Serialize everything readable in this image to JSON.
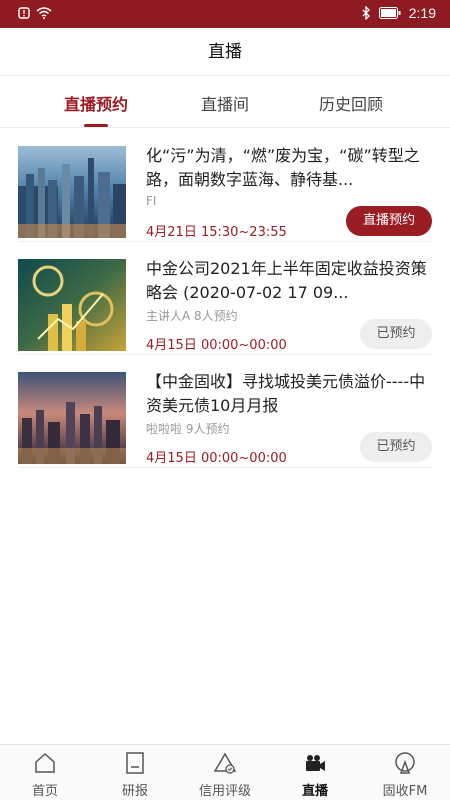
{
  "status_bar": {
    "time": "2:19"
  },
  "header": {
    "title": "直播"
  },
  "tabs": [
    {
      "label": "直播预约"
    },
    {
      "label": "直播间"
    },
    {
      "label": "历史回顾"
    }
  ],
  "items": [
    {
      "title": "化“污”为清，“燃”废为宝，“碳”转型之路，面朝数字蓝海、静待基...",
      "sub": "FI",
      "date": "4月21日 15:30~23:55",
      "button": "直播预约"
    },
    {
      "title": "中金公司2021年上半年固定收益投资策略会 (2020-07-02 17 09...",
      "sub": "主讲人A 8人预约",
      "date": "4月15日 00:00~00:00",
      "button": "已预约"
    },
    {
      "title": "【中金固收】寻找城投美元债溢价----中资美元债10月月报",
      "sub": "啦啦啦 9人预约",
      "date": "4月15日 00:00~00:00",
      "button": "已预约"
    }
  ],
  "nav": [
    {
      "label": "首页",
      "icon": "home-icon"
    },
    {
      "label": "研报",
      "icon": "report-icon"
    },
    {
      "label": "信用评级",
      "icon": "rating-icon"
    },
    {
      "label": "直播",
      "icon": "video-camera-icon"
    },
    {
      "label": "固收FM",
      "icon": "radio-icon"
    }
  ],
  "colors": {
    "brand": "#9b1d24",
    "status_bar": "#8e1b22"
  }
}
